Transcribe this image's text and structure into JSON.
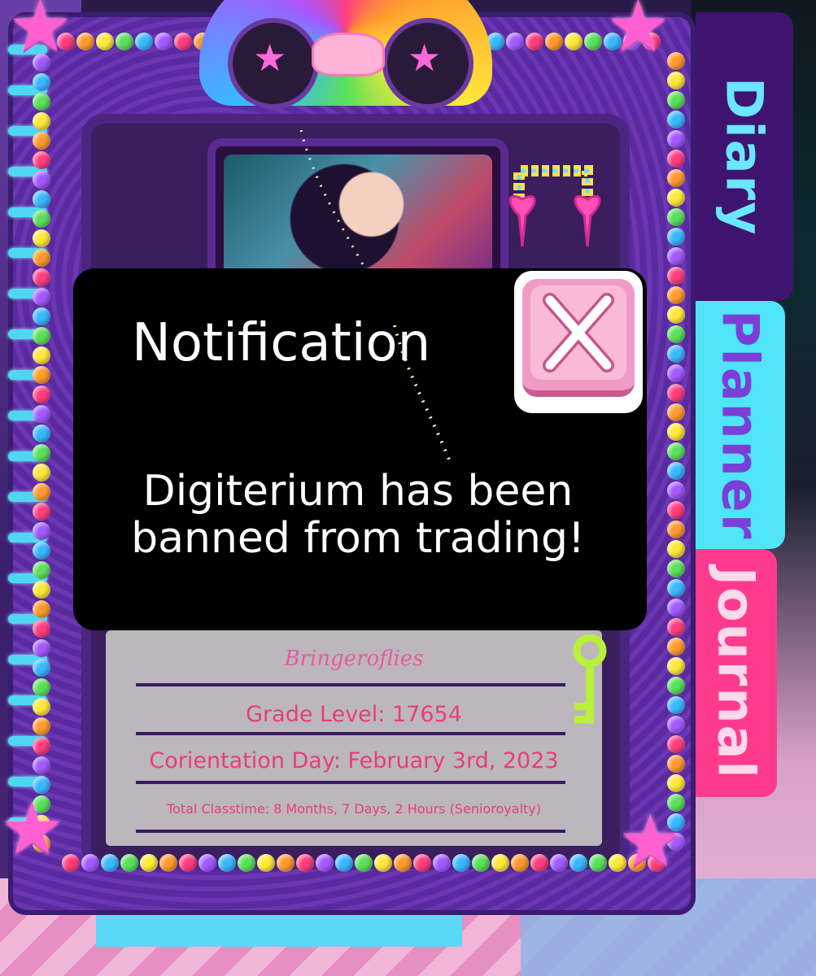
{
  "tabs": {
    "diary": "Diary",
    "planner": "Planner",
    "journal": "Journal"
  },
  "profile": {
    "username": "Bringeroflies",
    "grade_level": "Grade Level: 17654",
    "orientation_day": "Corientation Day: February 3rd, 2023",
    "total_classtime": "Total Classtime: 8 Months, 7 Days, 2 Hours (Senioroyalty)"
  },
  "notification": {
    "title": "Notification",
    "message": "Digiterium has been banned from trading!",
    "close_icon": "close-x-icon"
  },
  "colors": {
    "modal_bg": "#000000",
    "tab_diary": "#3e1470",
    "tab_planner": "#4fe4f7",
    "tab_journal": "#ff3b8e",
    "profile_text": "#ea3b7d",
    "close_button": "#f8bad8"
  }
}
